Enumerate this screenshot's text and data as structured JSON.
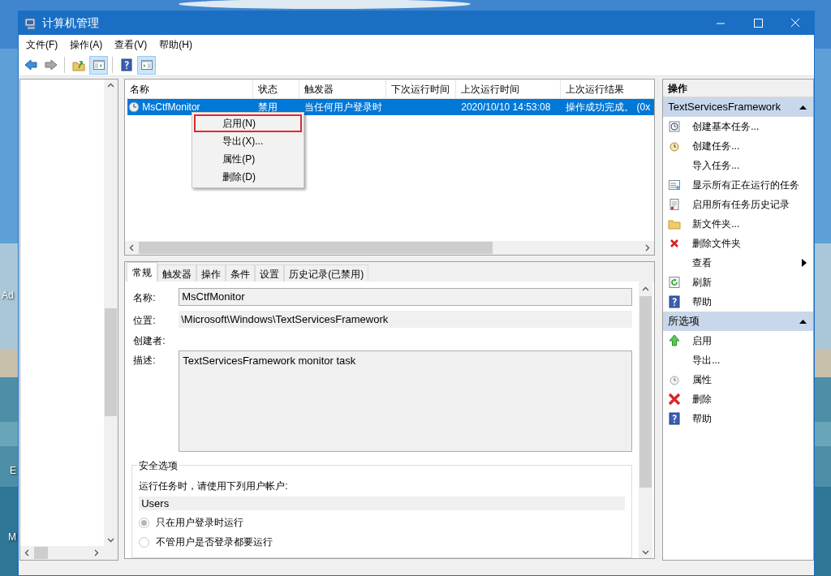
{
  "desktop_labels": [
    "Ad",
    "E",
    "M"
  ],
  "window": {
    "title": "计算机管理"
  },
  "menu_bar": [
    "文件(F)",
    "操作(A)",
    "查看(V)",
    "帮助(H)"
  ],
  "toolbar": [
    {
      "kind": "back",
      "pressed": false
    },
    {
      "kind": "forward",
      "pressed": false
    },
    {
      "kind": "separator"
    },
    {
      "kind": "up",
      "pressed": false
    },
    {
      "kind": "tree",
      "pressed": true
    },
    {
      "kind": "separator"
    },
    {
      "kind": "help",
      "pressed": false
    },
    {
      "kind": "pane",
      "pressed": true
    }
  ],
  "task_list": {
    "columns": [
      "名称",
      "状态",
      "触发器",
      "下次运行时间",
      "上次运行时间",
      "上次运行结果"
    ],
    "rows": [
      {
        "name": "MsCtfMonitor",
        "status": "禁用",
        "trigger": "当任何用户登录时",
        "last_run_time": "2020/10/10 14:53:08",
        "last_run_result": "操作成功完成。 (0x",
        "selected": true
      }
    ]
  },
  "context_menu": [
    {
      "label": "启用(N)",
      "highlighted": true
    },
    {
      "label": "导出(X)...",
      "highlighted": false
    },
    {
      "label": "属性(P)",
      "highlighted": false
    },
    {
      "label": "删除(D)",
      "highlighted": false
    }
  ],
  "details": {
    "tabs": [
      {
        "label": "常规",
        "selected": true
      },
      {
        "label": "触发器",
        "selected": false
      },
      {
        "label": "操作",
        "selected": false
      },
      {
        "label": "条件",
        "selected": false
      },
      {
        "label": "设置",
        "selected": false
      },
      {
        "label": "历史记录(已禁用)",
        "selected": false
      }
    ],
    "name_label": "名称:",
    "name_value": "MsCtfMonitor",
    "location_label": "位置:",
    "location_value": "\\Microsoft\\Windows\\TextServicesFramework",
    "author_label": "创建者:",
    "description_label": "描述:",
    "description_value": "TextServicesFramework monitor task",
    "security": {
      "title": "安全选项",
      "account_prompt": "运行任务时，请使用下列用户帐户:",
      "account": "Users",
      "options": [
        {
          "label": "只在用户登录时运行",
          "selected": true
        },
        {
          "label": "不管用户是否登录都要运行",
          "selected": false
        }
      ]
    }
  },
  "actions_pane": {
    "title": "操作",
    "sections": [
      {
        "title": "TextServicesFramework",
        "expanded": true,
        "items": [
          {
            "label": "创建基本任务...",
            "kind": "basic-task"
          },
          {
            "label": "创建任务...",
            "kind": "task"
          },
          {
            "label": "导入任务...",
            "kind": "plain"
          },
          {
            "label": "显示所有正在运行的任务",
            "kind": "running"
          },
          {
            "label": "启用所有任务历史记录",
            "kind": "history"
          },
          {
            "label": "新文件夹...",
            "kind": "folder"
          },
          {
            "label": "删除文件夹",
            "kind": "delete"
          },
          {
            "label": "查看",
            "kind": "submenu"
          },
          {
            "label": "刷新",
            "kind": "refresh"
          },
          {
            "label": "帮助",
            "kind": "help"
          }
        ]
      },
      {
        "title": "所选项",
        "expanded": true,
        "items": [
          {
            "label": "启用",
            "kind": "enable"
          },
          {
            "label": "导出...",
            "kind": "plain"
          },
          {
            "label": "属性",
            "kind": "properties"
          },
          {
            "label": "删除",
            "kind": "delete-big"
          },
          {
            "label": "帮助",
            "kind": "help"
          }
        ]
      }
    ]
  }
}
